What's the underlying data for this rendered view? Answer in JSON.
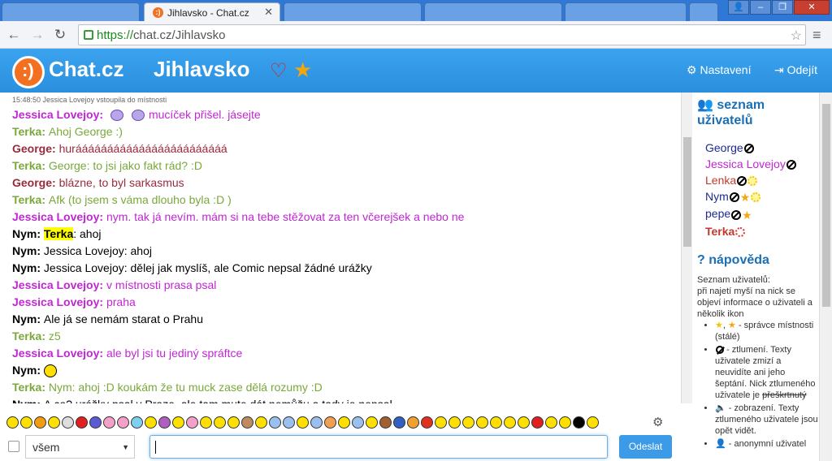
{
  "browser": {
    "active_tab_title": "Jihlavsko - Chat.cz",
    "url_scheme": "https://",
    "url_rest": "chat.cz/Jihlavsko"
  },
  "app": {
    "brand": "Chat.cz",
    "room": "Jihlavsko",
    "settings_label": "Nastavení",
    "logout_label": "Odejít"
  },
  "chat": {
    "system_line": "15:48:50 Jessica Lovejoy vstoupila do místnosti",
    "messages": [
      {
        "nick": "Jessica Lovejoy:",
        "text": "mucíček přišel. jásejte",
        "color": "#c026d3",
        "smileys": true
      },
      {
        "nick": "Terka:",
        "text": "Ahoj George :)",
        "color": "#7aa83a"
      },
      {
        "nick": "George:",
        "text": "huráááááááááááááááááááááááá",
        "color": "#9b2a3b"
      },
      {
        "nick": "Terka:",
        "text": "George: to jsi jako fakt rád? :D",
        "color": "#7aa83a"
      },
      {
        "nick": "George:",
        "text": "blázne, to byl sarkasmus",
        "color": "#9b2a3b"
      },
      {
        "nick": "Terka:",
        "text": "Afk (to jsem s váma dlouho byla :D )",
        "color": "#7aa83a"
      },
      {
        "nick": "Jessica Lovejoy:",
        "text": "nym. tak já nevím. mám si na tebe stěžovat za ten včerejšek a nebo ne",
        "color": "#c026d3"
      },
      {
        "nick": "Nym:",
        "highlight": "Terka",
        "text": ": ahoj",
        "color": "#000000"
      },
      {
        "nick": "Nym:",
        "text": "Jessica Lovejoy: ahoj",
        "color": "#000000"
      },
      {
        "nick": "Nym:",
        "text": "Jessica Lovejoy: dělej jak myslíš, ale Comic nepsal žádné urážky",
        "color": "#000000"
      },
      {
        "nick": "Jessica Lovejoy:",
        "text": "v místnosti prasa psal",
        "color": "#c026d3"
      },
      {
        "nick": "Jessica Lovejoy:",
        "text": "praha",
        "color": "#c026d3"
      },
      {
        "nick": "Nym:",
        "text": "Ale já se nemám starat o Prahu",
        "color": "#000000"
      },
      {
        "nick": "Terka:",
        "text": "z5",
        "color": "#7aa83a"
      },
      {
        "nick": "Jessica Lovejoy:",
        "text": "ale byl jsi tu jediný spráftce",
        "color": "#c026d3"
      },
      {
        "nick": "Nym:",
        "text": "",
        "color": "#000000",
        "yellow_smiley": true
      },
      {
        "nick": "Terka:",
        "text": "Nym: ahoj :D koukám že tu muck zase dělá rozumy :D",
        "color": "#7aa83a"
      },
      {
        "nick": "Nym:",
        "text": "A co? urážky psal v Praze, ale tam mute dát nemůžu a tady je nepsal",
        "color": "#000000"
      }
    ]
  },
  "sidebar": {
    "users_title": "seznam uživatelů",
    "users": [
      {
        "name": "George",
        "color": "#1e2b8f",
        "icons": [
          "mute"
        ]
      },
      {
        "name": "Jessica Lovejoy",
        "color": "#c026d3",
        "icons": [
          "mute"
        ]
      },
      {
        "name": "Lenka",
        "color": "#c0392b",
        "icons": [
          "mute",
          "sun"
        ]
      },
      {
        "name": "Nym",
        "color": "#1e2b8f",
        "icons": [
          "mute",
          "star",
          "sun"
        ]
      },
      {
        "name": "pepe",
        "color": "#1e2b8f",
        "icons": [
          "mute",
          "star"
        ]
      },
      {
        "name": "Terka",
        "color": "#c0392b",
        "icons": [
          "sun-red"
        ]
      }
    ],
    "help_title": "nápověda",
    "help_intro_1": "Seznam uživatelů:",
    "help_intro_2": "při najetí myší na nick se objeví informace o uživateli a několik ikon",
    "help_items": [
      "- správce místnosti (stálé)",
      "- ztlumení. Texty uživatele zmizí a neuvidíte ani jeho šeptání. Nick ztlumeného uživatele je",
      "- zobrazení. Texty ztlumeného uživatele jsou opět vidět.",
      "- anonymní uživatel"
    ],
    "help_strike": "přeškrtnutý"
  },
  "input": {
    "target_select": "všem",
    "send_label": "Odeslat"
  }
}
